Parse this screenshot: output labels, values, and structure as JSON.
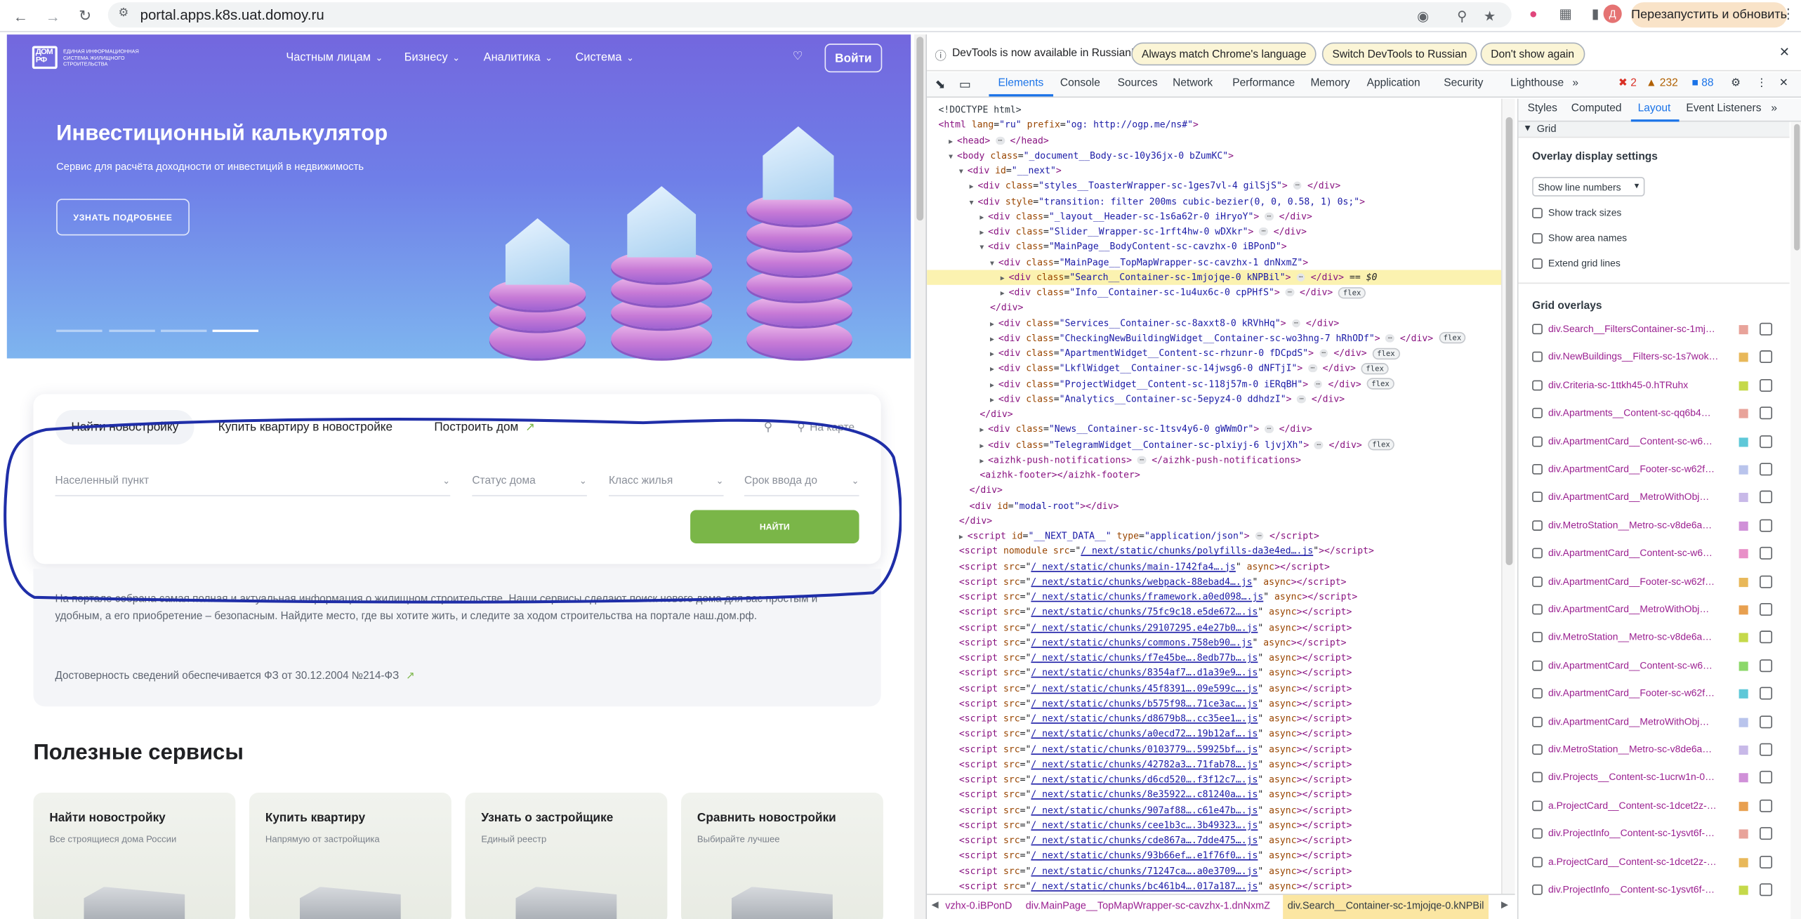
{
  "browser": {
    "url": "portal.apps.k8s.uat.domoy.ru",
    "relaunch_label": "Перезапустить и обновить",
    "profile_letter": "Д"
  },
  "site": {
    "logo_text": "ДОМ РФ",
    "logo_caption": "ЕДИНАЯ ИНФОРМАЦИОННАЯ СИСТЕМА ЖИЛИЩНОГО СТРОИТЕЛЬСТВА",
    "nav": [
      "Частным лицам",
      "Бизнесу",
      "Аналитика",
      "Система"
    ],
    "login_label": "Войти",
    "hero_title": "Инвестиционный калькулятор",
    "hero_subtitle": "Сервис для расчёта доходности от инвестиций в недвижимость",
    "hero_button": "УЗНАТЬ ПОДРОБНЕЕ",
    "search": {
      "tabs": [
        "Найти новостройку",
        "Купить квартиру в новостройке",
        "Построить дом"
      ],
      "map_label": "На карте",
      "fields": [
        "Населенный пункт",
        "Статус дома",
        "Класс жилья",
        "Срок ввода до"
      ],
      "find_button": "НАЙТИ"
    },
    "info_text": "На портале собрана самая полная и актуальная информация о жилищном строительстве. Наши сервисы сделают поиск нового дома для вас простым и удобным, а его приобретение – безопасным. Найдите место, где вы хотите жить, и следите за ходом строительства на портале наш.дом.рф.",
    "info_note": "Достоверность сведений обеспечивается ФЗ от 30.12.2004 №214-ФЗ",
    "services_title": "Полезные сервисы",
    "services": [
      {
        "title": "Найти новостройку",
        "subtitle": "Все строящиеся дома России"
      },
      {
        "title": "Купить квартиру",
        "subtitle": "Напрямую от застройщика"
      },
      {
        "title": "Узнать о застройщике",
        "subtitle": "Единый реестр"
      },
      {
        "title": "Сравнить новостройки",
        "subtitle": "Выбирайте лучшее"
      }
    ]
  },
  "devtools": {
    "infobar": {
      "message": "DevTools is now available in Russian!",
      "btn1": "Always match Chrome's language",
      "btn2": "Switch DevTools to Russian",
      "btn3": "Don't show again"
    },
    "tabs": [
      "Elements",
      "Console",
      "Sources",
      "Network",
      "Performance",
      "Memory",
      "Application",
      "Security",
      "Lighthouse"
    ],
    "errors": "2",
    "warnings": "232",
    "issues": "88",
    "side_tabs": [
      "Styles",
      "Computed",
      "Layout",
      "Event Listeners"
    ],
    "grid_section": "Grid",
    "overlay_settings": "Overlay display settings",
    "line_numbers_select": "Show line numbers",
    "options": [
      "Show track sizes",
      "Show area names",
      "Extend grid lines"
    ],
    "grid_overlays_title": "Grid overlays",
    "grid_overlays": [
      {
        "label": "div.Search__FiltersContainer-sc-1mj…",
        "color": "#e8a39a"
      },
      {
        "label": "div.NewBuildings__Filters-sc-1s7wok…",
        "color": "#e8b85a"
      },
      {
        "label": "div.Criteria-sc-1ttkh45-0.hTRuhx",
        "color": "#c5d94a"
      },
      {
        "label": "div.Apartments__Content-sc-qq6b4…",
        "color": "#e8a39a"
      },
      {
        "label": "div.ApartmentCard__Content-sc-w6…",
        "color": "#5ec8d8"
      },
      {
        "label": "div.ApartmentCard__Footer-sc-w62f…",
        "color": "#b9c4ec"
      },
      {
        "label": "div.ApartmentCard__MetroWithObj…",
        "color": "#c8b9e8"
      },
      {
        "label": "div.MetroStation__Metro-sc-v8de6a…",
        "color": "#d090d8"
      },
      {
        "label": "div.ApartmentCard__Content-sc-w6…",
        "color": "#e890c8"
      },
      {
        "label": "div.ApartmentCard__Footer-sc-w62f…",
        "color": "#e8b85a"
      },
      {
        "label": "div.ApartmentCard__MetroWithObj…",
        "color": "#e8a050"
      },
      {
        "label": "div.MetroStation__Metro-sc-v8de6a…",
        "color": "#c5d94a"
      },
      {
        "label": "div.ApartmentCard__Content-sc-w6…",
        "color": "#8cd86a"
      },
      {
        "label": "div.ApartmentCard__Footer-sc-w62f…",
        "color": "#5ec8d8"
      },
      {
        "label": "div.ApartmentCard__MetroWithObj…",
        "color": "#b9c4ec"
      },
      {
        "label": "div.MetroStation__Metro-sc-v8de6a…",
        "color": "#c8b9e8"
      },
      {
        "label": "div.Projects__Content-sc-1ucrw1n-0…",
        "color": "#d090d8"
      },
      {
        "label": "a.ProjectCard__Content-sc-1dcet2z-…",
        "color": "#e8a050"
      },
      {
        "label": "div.ProjectInfo__Content-sc-1ysvt6f-…",
        "color": "#e8a39a"
      },
      {
        "label": "a.ProjectCard__Content-sc-1dcet2z-…",
        "color": "#e8b85a"
      },
      {
        "label": "div.ProjectInfo__Content-sc-1ysvt6f-…",
        "color": "#c5d94a"
      }
    ],
    "breadcrumbs": [
      "vzhx-0.iBPonD",
      "div.MainPage__TopMapWrapper-sc-cavzhx-1.dnNxmZ",
      "div.Search__Container-sc-1mjojqe-0.kNPBil"
    ],
    "dom_lines": [
      {
        "indent": 0,
        "arrow": "",
        "html": "<span class='tx'>&lt;!DOCTYPE html&gt;</span>"
      },
      {
        "indent": 0,
        "arrow": "",
        "html": "<span class='tg'>&lt;html</span> <span class='at'>lang</span>=<span class='av'>\"ru\"</span> <span class='at'>prefix</span>=<span class='av'>\"og: http://ogp.me/ns#\"</span><span class='tg'>&gt;</span>"
      },
      {
        "indent": 1,
        "arrow": "▶",
        "html": "<span class='tg'>&lt;head&gt;</span> <span class='ell'>⋯</span> <span class='tg'>&lt;/head&gt;</span>"
      },
      {
        "indent": 1,
        "arrow": "▼",
        "html": "<span class='tg'>&lt;body</span> <span class='at'>class</span>=<span class='av'>\"_document__Body-sc-10y36jx-0 bZumKC\"</span><span class='tg'>&gt;</span>"
      },
      {
        "indent": 2,
        "arrow": "▼",
        "html": "<span class='tg'>&lt;div</span> <span class='at'>id</span>=<span class='av'>\"__next\"</span><span class='tg'>&gt;</span>"
      },
      {
        "indent": 3,
        "arrow": "▶",
        "html": "<span class='tg'>&lt;div</span> <span class='at'>class</span>=<span class='av'>\"styles__ToasterWrapper-sc-1ges7vl-4 gilSjS\"</span><span class='tg'>&gt;</span> <span class='ell'>⋯</span> <span class='tg'>&lt;/div&gt;</span>"
      },
      {
        "indent": 3,
        "arrow": "▼",
        "html": "<span class='tg'>&lt;div</span> <span class='at'>style</span>=<span class='av'>\"transition: filter 200ms cubic-bezier(0, 0, 0.58, 1) 0s;\"</span><span class='tg'>&gt;</span>"
      },
      {
        "indent": 4,
        "arrow": "▶",
        "html": "<span class='tg'>&lt;div</span> <span class='at'>class</span>=<span class='av'>\"_layout__Header-sc-1s6a62r-0 iHryoY\"</span><span class='tg'>&gt;</span> <span class='ell'>⋯</span> <span class='tg'>&lt;/div&gt;</span>"
      },
      {
        "indent": 4,
        "arrow": "▶",
        "html": "<span class='tg'>&lt;div</span> <span class='at'>class</span>=<span class='av'>\"Slider__Wrapper-sc-1rft4hw-0 wDXkr\"</span><span class='tg'>&gt;</span> <span class='ell'>⋯</span> <span class='tg'>&lt;/div&gt;</span>"
      },
      {
        "indent": 4,
        "arrow": "▼",
        "html": "<span class='tg'>&lt;div</span> <span class='at'>class</span>=<span class='av'>\"MainPage__BodyContent-sc-cavzhx-0 iBPonD\"</span><span class='tg'>&gt;</span>"
      },
      {
        "indent": 5,
        "arrow": "▼",
        "html": "<span class='tg'>&lt;div</span> <span class='at'>class</span>=<span class='av'>\"MainPage__TopMapWrapper-sc-cavzhx-1 dnNxmZ\"</span><span class='tg'>&gt;</span>"
      },
      {
        "indent": 6,
        "arrow": "▶",
        "sel": true,
        "html": "<span class='tg'>&lt;div</span> <span class='at'>class</span>=<span class='av'>\"Search__Container-sc-1mjojqe-0 kNPBil\"</span><span class='tg'>&gt;</span> <span class='ell'>⋯</span> <span class='tg'>&lt;/div&gt;</span> == <i>$0</i>"
      },
      {
        "indent": 6,
        "arrow": "▶",
        "html": "<span class='tg'>&lt;div</span> <span class='at'>class</span>=<span class='av'>\"Info__Container-sc-1u4ux6c-0 cpPHfS\"</span><span class='tg'>&gt;</span> <span class='ell'>⋯</span> <span class='tg'>&lt;/div&gt;</span> <span class='badge'>flex</span>"
      },
      {
        "indent": 5,
        "arrow": "",
        "html": "<span class='tg'>&lt;/div&gt;</span>"
      },
      {
        "indent": 5,
        "arrow": "▶",
        "html": "<span class='tg'>&lt;div</span> <span class='at'>class</span>=<span class='av'>\"Services__Container-sc-8axxt8-0 kRVhHq\"</span><span class='tg'>&gt;</span> <span class='ell'>⋯</span> <span class='tg'>&lt;/div&gt;</span>"
      },
      {
        "indent": 5,
        "arrow": "▶",
        "html": "<span class='tg'>&lt;div</span> <span class='at'>class</span>=<span class='av'>\"CheckingNewBuildingWidget__Container-sc-wo3hng-7 hRhODf\"</span><span class='tg'>&gt;</span> <span class='ell'>⋯</span> <span class='tg'>&lt;/div&gt;</span> <span class='badge'>flex</span>"
      },
      {
        "indent": 5,
        "arrow": "▶",
        "html": "<span class='tg'>&lt;div</span> <span class='at'>class</span>=<span class='av'>\"ApartmentWidget__Content-sc-rhzunr-0 fDCpdS\"</span><span class='tg'>&gt;</span> <span class='ell'>⋯</span> <span class='tg'>&lt;/div&gt;</span> <span class='badge'>flex</span>"
      },
      {
        "indent": 5,
        "arrow": "▶",
        "html": "<span class='tg'>&lt;div</span> <span class='at'>class</span>=<span class='av'>\"LkflWidget__Container-sc-14jwsg6-0 dNFTjI\"</span><span class='tg'>&gt;</span> <span class='ell'>⋯</span> <span class='tg'>&lt;/div&gt;</span> <span class='badge'>flex</span>"
      },
      {
        "indent": 5,
        "arrow": "▶",
        "html": "<span class='tg'>&lt;div</span> <span class='at'>class</span>=<span class='av'>\"ProjectWidget__Content-sc-118j57m-0 iERqBH\"</span><span class='tg'>&gt;</span> <span class='ell'>⋯</span> <span class='tg'>&lt;/div&gt;</span> <span class='badge'>flex</span>"
      },
      {
        "indent": 5,
        "arrow": "▶",
        "html": "<span class='tg'>&lt;div</span> <span class='at'>class</span>=<span class='av'>\"Analytics__Container-sc-5epyz4-0 ddhdzI\"</span><span class='tg'>&gt;</span> <span class='ell'>⋯</span> <span class='tg'>&lt;/div&gt;</span>"
      },
      {
        "indent": 4,
        "arrow": "",
        "html": "<span class='tg'>&lt;/div&gt;</span>"
      },
      {
        "indent": 4,
        "arrow": "▶",
        "html": "<span class='tg'>&lt;div</span> <span class='at'>class</span>=<span class='av'>\"News__Container-sc-1tsv4y6-0 gWWmOr\"</span><span class='tg'>&gt;</span> <span class='ell'>⋯</span> <span class='tg'>&lt;/div&gt;</span>"
      },
      {
        "indent": 4,
        "arrow": "▶",
        "html": "<span class='tg'>&lt;div</span> <span class='at'>class</span>=<span class='av'>\"TelegramWidget__Container-sc-plxiyj-6 ljvjXh\"</span><span class='tg'>&gt;</span> <span class='ell'>⋯</span> <span class='tg'>&lt;/div&gt;</span> <span class='badge'>flex</span>"
      },
      {
        "indent": 4,
        "arrow": "▶",
        "html": "<span class='tg'>&lt;aizhk-push-notifications&gt;</span> <span class='ell'>⋯</span> <span class='tg'>&lt;/aizhk-push-notifications&gt;</span>"
      },
      {
        "indent": 4,
        "arrow": "",
        "html": "<span class='tg'>&lt;aizhk-footer&gt;&lt;/aizhk-footer&gt;</span>"
      },
      {
        "indent": 3,
        "arrow": "",
        "html": "<span class='tg'>&lt;/div&gt;</span>"
      },
      {
        "indent": 3,
        "arrow": "",
        "html": "<span class='tg'>&lt;div</span> <span class='at'>id</span>=<span class='av'>\"modal-root\"</span><span class='tg'>&gt;&lt;/div&gt;</span>"
      },
      {
        "indent": 2,
        "arrow": "",
        "html": "<span class='tg'>&lt;/div&gt;</span>"
      },
      {
        "indent": 2,
        "arrow": "▶",
        "html": "<span class='tg'>&lt;script</span> <span class='at'>id</span>=<span class='av'>\"__NEXT_DATA__\"</span> <span class='at'>type</span>=<span class='av'>\"application/json\"</span><span class='tg'>&gt;</span> <span class='ell'>⋯</span> <span class='tg'>&lt;/script&gt;</span>"
      },
      {
        "indent": 2,
        "arrow": "",
        "html": "<span class='tg'>&lt;script</span> <span class='at'>nomodule</span> <span class='at'>src</span>=\"<span class='lk'>/_next/static/chunks/polyfills-da3e4ed….js</span>\"<span class='tg'>&gt;&lt;/script&gt;</span>"
      },
      {
        "indent": 2,
        "arrow": "",
        "html": "<span class='tg'>&lt;script</span> <span class='at'>src</span>=\"<span class='lk'>/_next/static/chunks/main-1742fa4….js</span>\" <span class='at'>async</span><span class='tg'>&gt;&lt;/script&gt;</span>"
      },
      {
        "indent": 2,
        "arrow": "",
        "html": "<span class='tg'>&lt;script</span> <span class='at'>src</span>=\"<span class='lk'>/_next/static/chunks/webpack-88ebad4….js</span>\" <span class='at'>async</span><span class='tg'>&gt;&lt;/script&gt;</span>"
      },
      {
        "indent": 2,
        "arrow": "",
        "html": "<span class='tg'>&lt;script</span> <span class='at'>src</span>=\"<span class='lk'>/_next/static/chunks/framework.a0ed098….js</span>\" <span class='at'>async</span><span class='tg'>&gt;&lt;/script&gt;</span>"
      },
      {
        "indent": 2,
        "arrow": "",
        "html": "<span class='tg'>&lt;script</span> <span class='at'>src</span>=\"<span class='lk'>/_next/static/chunks/75fc9c18.e5de672….js</span>\" <span class='at'>async</span><span class='tg'>&gt;&lt;/script&gt;</span>"
      },
      {
        "indent": 2,
        "arrow": "",
        "html": "<span class='tg'>&lt;script</span> <span class='at'>src</span>=\"<span class='lk'>/_next/static/chunks/29107295.e4e27b0….js</span>\" <span class='at'>async</span><span class='tg'>&gt;&lt;/script&gt;</span>"
      },
      {
        "indent": 2,
        "arrow": "",
        "html": "<span class='tg'>&lt;script</span> <span class='at'>src</span>=\"<span class='lk'>/_next/static/chunks/commons.758eb90….js</span>\" <span class='at'>async</span><span class='tg'>&gt;&lt;/script&gt;</span>"
      },
      {
        "indent": 2,
        "arrow": "",
        "html": "<span class='tg'>&lt;script</span> <span class='at'>src</span>=\"<span class='lk'>/_next/static/chunks/f7e45be….8edb77b….js</span>\" <span class='at'>async</span><span class='tg'>&gt;&lt;/script&gt;</span>"
      },
      {
        "indent": 2,
        "arrow": "",
        "html": "<span class='tg'>&lt;script</span> <span class='at'>src</span>=\"<span class='lk'>/_next/static/chunks/8354af7….d1a39e9….js</span>\" <span class='at'>async</span><span class='tg'>&gt;&lt;/script&gt;</span>"
      },
      {
        "indent": 2,
        "arrow": "",
        "html": "<span class='tg'>&lt;script</span> <span class='at'>src</span>=\"<span class='lk'>/_next/static/chunks/45f8391….09e599c….js</span>\" <span class='at'>async</span><span class='tg'>&gt;&lt;/script&gt;</span>"
      },
      {
        "indent": 2,
        "arrow": "",
        "html": "<span class='tg'>&lt;script</span> <span class='at'>src</span>=\"<span class='lk'>/_next/static/chunks/b575f98….71ce3ac….js</span>\" <span class='at'>async</span><span class='tg'>&gt;&lt;/script&gt;</span>"
      },
      {
        "indent": 2,
        "arrow": "",
        "html": "<span class='tg'>&lt;script</span> <span class='at'>src</span>=\"<span class='lk'>/_next/static/chunks/d8679b8….cc35ee1….js</span>\" <span class='at'>async</span><span class='tg'>&gt;&lt;/script&gt;</span>"
      },
      {
        "indent": 2,
        "arrow": "",
        "html": "<span class='tg'>&lt;script</span> <span class='at'>src</span>=\"<span class='lk'>/_next/static/chunks/a0ecd72….19b12af….js</span>\" <span class='at'>async</span><span class='tg'>&gt;&lt;/script&gt;</span>"
      },
      {
        "indent": 2,
        "arrow": "",
        "html": "<span class='tg'>&lt;script</span> <span class='at'>src</span>=\"<span class='lk'>/_next/static/chunks/0103779….59925bf….js</span>\" <span class='at'>async</span><span class='tg'>&gt;&lt;/script&gt;</span>"
      },
      {
        "indent": 2,
        "arrow": "",
        "html": "<span class='tg'>&lt;script</span> <span class='at'>src</span>=\"<span class='lk'>/_next/static/chunks/42782a3….71fab78….js</span>\" <span class='at'>async</span><span class='tg'>&gt;&lt;/script&gt;</span>"
      },
      {
        "indent": 2,
        "arrow": "",
        "html": "<span class='tg'>&lt;script</span> <span class='at'>src</span>=\"<span class='lk'>/_next/static/chunks/d6cd520….f3f12c7….js</span>\" <span class='at'>async</span><span class='tg'>&gt;&lt;/script&gt;</span>"
      },
      {
        "indent": 2,
        "arrow": "",
        "html": "<span class='tg'>&lt;script</span> <span class='at'>src</span>=\"<span class='lk'>/_next/static/chunks/8e35922….c81240a….js</span>\" <span class='at'>async</span><span class='tg'>&gt;&lt;/script&gt;</span>"
      },
      {
        "indent": 2,
        "arrow": "",
        "html": "<span class='tg'>&lt;script</span> <span class='at'>src</span>=\"<span class='lk'>/_next/static/chunks/907af88….c61e47b….js</span>\" <span class='at'>async</span><span class='tg'>&gt;&lt;/script&gt;</span>"
      },
      {
        "indent": 2,
        "arrow": "",
        "html": "<span class='tg'>&lt;script</span> <span class='at'>src</span>=\"<span class='lk'>/_next/static/chunks/cee1b3c….3b49323….js</span>\" <span class='at'>async</span><span class='tg'>&gt;&lt;/script&gt;</span>"
      },
      {
        "indent": 2,
        "arrow": "",
        "html": "<span class='tg'>&lt;script</span> <span class='at'>src</span>=\"<span class='lk'>/_next/static/chunks/cde867a….7dde475….js</span>\" <span class='at'>async</span><span class='tg'>&gt;&lt;/script&gt;</span>"
      },
      {
        "indent": 2,
        "arrow": "",
        "html": "<span class='tg'>&lt;script</span> <span class='at'>src</span>=\"<span class='lk'>/_next/static/chunks/93b66ef….e1f76f0….js</span>\" <span class='at'>async</span><span class='tg'>&gt;&lt;/script&gt;</span>"
      },
      {
        "indent": 2,
        "arrow": "",
        "html": "<span class='tg'>&lt;script</span> <span class='at'>src</span>=\"<span class='lk'>/_next/static/chunks/71247ca….a0e3709….js</span>\" <span class='at'>async</span><span class='tg'>&gt;&lt;/script&gt;</span>"
      },
      {
        "indent": 2,
        "arrow": "",
        "html": "<span class='tg'>&lt;script</span> <span class='at'>src</span>=\"<span class='lk'>/_next/static/chunks/bc461b4….017a187….js</span>\" <span class='at'>async</span><span class='tg'>&gt;&lt;/script&gt;</span>"
      }
    ]
  }
}
